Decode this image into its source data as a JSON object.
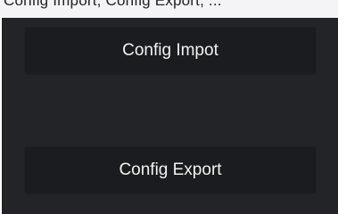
{
  "header": {
    "cut_text": "Config Import, Config Export, ..."
  },
  "panel": {
    "import_label": "Config Impot",
    "export_label": "Config Export"
  }
}
